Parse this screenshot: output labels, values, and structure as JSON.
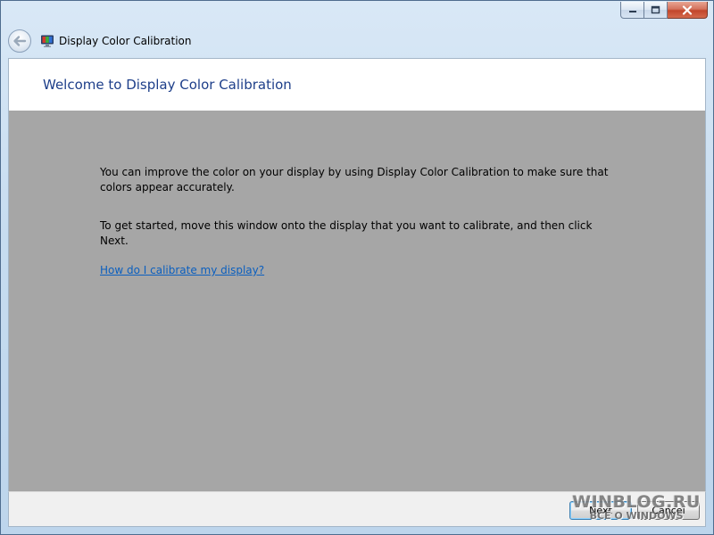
{
  "window": {
    "title": "Display Color Calibration"
  },
  "icons": {
    "back": "back-arrow-icon",
    "app": "display-calibration-icon",
    "minimize": "minimize-icon",
    "maximize": "restore-icon",
    "close": "close-icon"
  },
  "page": {
    "title": "Welcome to Display Color Calibration",
    "paragraph1": "You can improve the color on your display by using Display Color Calibration to make sure that colors appear accurately.",
    "paragraph2": "To get started, move this window onto the display that you want to calibrate, and then click Next.",
    "help_link": "How do I calibrate my display?"
  },
  "footer": {
    "next_label": "Next",
    "cancel_label": "Cancel"
  },
  "watermark": {
    "main": "WINBLOG.RU",
    "sub": "ВСЁ О WINDOWS"
  },
  "colors": {
    "title_text": "#1e3f8a",
    "content_background": "#a6a6a6",
    "link": "#0b5fbf",
    "close_button": "#c2462b"
  }
}
